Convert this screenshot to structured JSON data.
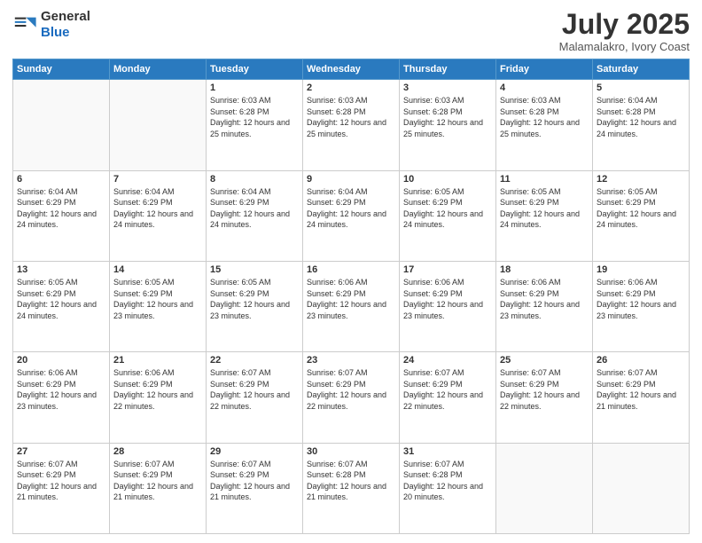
{
  "logo": {
    "general": "General",
    "blue": "Blue"
  },
  "header": {
    "month": "July 2025",
    "location": "Malamalakro, Ivory Coast"
  },
  "weekdays": [
    "Sunday",
    "Monday",
    "Tuesday",
    "Wednesday",
    "Thursday",
    "Friday",
    "Saturday"
  ],
  "weeks": [
    [
      {
        "day": "",
        "info": ""
      },
      {
        "day": "",
        "info": ""
      },
      {
        "day": "1",
        "info": "Sunrise: 6:03 AM\nSunset: 6:28 PM\nDaylight: 12 hours and 25 minutes."
      },
      {
        "day": "2",
        "info": "Sunrise: 6:03 AM\nSunset: 6:28 PM\nDaylight: 12 hours and 25 minutes."
      },
      {
        "day": "3",
        "info": "Sunrise: 6:03 AM\nSunset: 6:28 PM\nDaylight: 12 hours and 25 minutes."
      },
      {
        "day": "4",
        "info": "Sunrise: 6:03 AM\nSunset: 6:28 PM\nDaylight: 12 hours and 25 minutes."
      },
      {
        "day": "5",
        "info": "Sunrise: 6:04 AM\nSunset: 6:28 PM\nDaylight: 12 hours and 24 minutes."
      }
    ],
    [
      {
        "day": "6",
        "info": "Sunrise: 6:04 AM\nSunset: 6:29 PM\nDaylight: 12 hours and 24 minutes."
      },
      {
        "day": "7",
        "info": "Sunrise: 6:04 AM\nSunset: 6:29 PM\nDaylight: 12 hours and 24 minutes."
      },
      {
        "day": "8",
        "info": "Sunrise: 6:04 AM\nSunset: 6:29 PM\nDaylight: 12 hours and 24 minutes."
      },
      {
        "day": "9",
        "info": "Sunrise: 6:04 AM\nSunset: 6:29 PM\nDaylight: 12 hours and 24 minutes."
      },
      {
        "day": "10",
        "info": "Sunrise: 6:05 AM\nSunset: 6:29 PM\nDaylight: 12 hours and 24 minutes."
      },
      {
        "day": "11",
        "info": "Sunrise: 6:05 AM\nSunset: 6:29 PM\nDaylight: 12 hours and 24 minutes."
      },
      {
        "day": "12",
        "info": "Sunrise: 6:05 AM\nSunset: 6:29 PM\nDaylight: 12 hours and 24 minutes."
      }
    ],
    [
      {
        "day": "13",
        "info": "Sunrise: 6:05 AM\nSunset: 6:29 PM\nDaylight: 12 hours and 24 minutes."
      },
      {
        "day": "14",
        "info": "Sunrise: 6:05 AM\nSunset: 6:29 PM\nDaylight: 12 hours and 23 minutes."
      },
      {
        "day": "15",
        "info": "Sunrise: 6:05 AM\nSunset: 6:29 PM\nDaylight: 12 hours and 23 minutes."
      },
      {
        "day": "16",
        "info": "Sunrise: 6:06 AM\nSunset: 6:29 PM\nDaylight: 12 hours and 23 minutes."
      },
      {
        "day": "17",
        "info": "Sunrise: 6:06 AM\nSunset: 6:29 PM\nDaylight: 12 hours and 23 minutes."
      },
      {
        "day": "18",
        "info": "Sunrise: 6:06 AM\nSunset: 6:29 PM\nDaylight: 12 hours and 23 minutes."
      },
      {
        "day": "19",
        "info": "Sunrise: 6:06 AM\nSunset: 6:29 PM\nDaylight: 12 hours and 23 minutes."
      }
    ],
    [
      {
        "day": "20",
        "info": "Sunrise: 6:06 AM\nSunset: 6:29 PM\nDaylight: 12 hours and 23 minutes."
      },
      {
        "day": "21",
        "info": "Sunrise: 6:06 AM\nSunset: 6:29 PM\nDaylight: 12 hours and 22 minutes."
      },
      {
        "day": "22",
        "info": "Sunrise: 6:07 AM\nSunset: 6:29 PM\nDaylight: 12 hours and 22 minutes."
      },
      {
        "day": "23",
        "info": "Sunrise: 6:07 AM\nSunset: 6:29 PM\nDaylight: 12 hours and 22 minutes."
      },
      {
        "day": "24",
        "info": "Sunrise: 6:07 AM\nSunset: 6:29 PM\nDaylight: 12 hours and 22 minutes."
      },
      {
        "day": "25",
        "info": "Sunrise: 6:07 AM\nSunset: 6:29 PM\nDaylight: 12 hours and 22 minutes."
      },
      {
        "day": "26",
        "info": "Sunrise: 6:07 AM\nSunset: 6:29 PM\nDaylight: 12 hours and 21 minutes."
      }
    ],
    [
      {
        "day": "27",
        "info": "Sunrise: 6:07 AM\nSunset: 6:29 PM\nDaylight: 12 hours and 21 minutes."
      },
      {
        "day": "28",
        "info": "Sunrise: 6:07 AM\nSunset: 6:29 PM\nDaylight: 12 hours and 21 minutes."
      },
      {
        "day": "29",
        "info": "Sunrise: 6:07 AM\nSunset: 6:29 PM\nDaylight: 12 hours and 21 minutes."
      },
      {
        "day": "30",
        "info": "Sunrise: 6:07 AM\nSunset: 6:28 PM\nDaylight: 12 hours and 21 minutes."
      },
      {
        "day": "31",
        "info": "Sunrise: 6:07 AM\nSunset: 6:28 PM\nDaylight: 12 hours and 20 minutes."
      },
      {
        "day": "",
        "info": ""
      },
      {
        "day": "",
        "info": ""
      }
    ]
  ]
}
